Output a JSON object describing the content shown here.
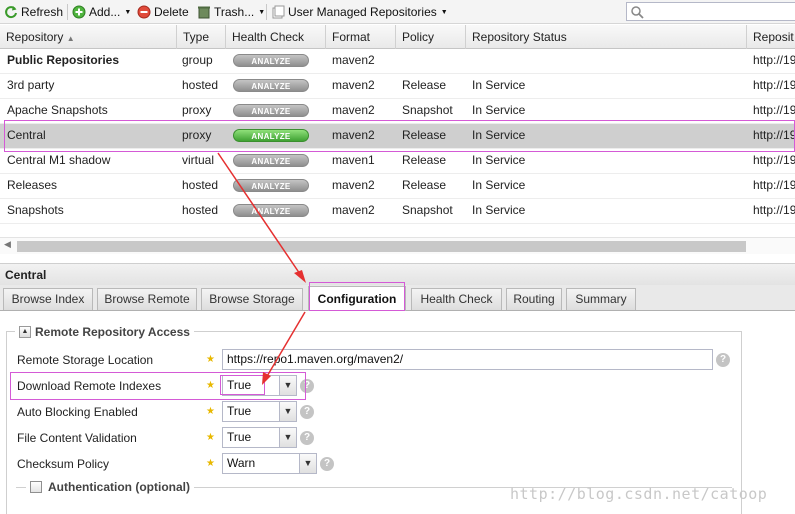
{
  "toolbar": {
    "refresh": "Refresh",
    "add": "Add...",
    "delete": "Delete",
    "trash": "Trash...",
    "user_managed": "User Managed Repositories",
    "search_placeholder": ""
  },
  "grid": {
    "columns": [
      "Repository",
      "Type",
      "Health Check",
      "Format",
      "Policy",
      "Repository Status",
      "Reposit"
    ],
    "rows": [
      {
        "name": "Public Repositories",
        "type": "group",
        "health": "ANALYZE",
        "format": "maven2",
        "policy": "",
        "status": "",
        "url": "http://19"
      },
      {
        "name": "3rd party",
        "type": "hosted",
        "health": "ANALYZE",
        "format": "maven2",
        "policy": "Release",
        "status": "In Service",
        "url": "http://19"
      },
      {
        "name": "Apache Snapshots",
        "type": "proxy",
        "health": "ANALYZE",
        "format": "maven2",
        "policy": "Snapshot",
        "status": "In Service",
        "url": "http://19"
      },
      {
        "name": "Central",
        "type": "proxy",
        "health": "ANALYZE",
        "format": "maven2",
        "policy": "Release",
        "status": "In Service",
        "url": "http://19"
      },
      {
        "name": "Central M1 shadow",
        "type": "virtual",
        "health": "ANALYZE",
        "format": "maven1",
        "policy": "Release",
        "status": "In Service",
        "url": "http://19"
      },
      {
        "name": "Releases",
        "type": "hosted",
        "health": "ANALYZE",
        "format": "maven2",
        "policy": "Release",
        "status": "In Service",
        "url": "http://19"
      },
      {
        "name": "Snapshots",
        "type": "hosted",
        "health": "ANALYZE",
        "format": "maven2",
        "policy": "Snapshot",
        "status": "In Service",
        "url": "http://19"
      }
    ]
  },
  "panel": {
    "title": "Central",
    "tabs": [
      "Browse Index",
      "Browse Remote",
      "Browse Storage",
      "Configuration",
      "Health Check",
      "Routing",
      "Summary"
    ]
  },
  "form": {
    "legend": "Remote Repository Access",
    "remote_storage_label": "Remote Storage Location",
    "remote_storage_value": "https://repo1.maven.org/maven2/",
    "download_indexes_label": "Download Remote Indexes",
    "download_indexes_value": "True",
    "auto_blocking_label": "Auto Blocking Enabled",
    "auto_blocking_value": "True",
    "file_validation_label": "File Content Validation",
    "file_validation_value": "True",
    "checksum_label": "Checksum Policy",
    "checksum_value": "Warn",
    "auth_legend": "Authentication (optional)"
  },
  "watermark": "http://blog.csdn.net/catoop"
}
